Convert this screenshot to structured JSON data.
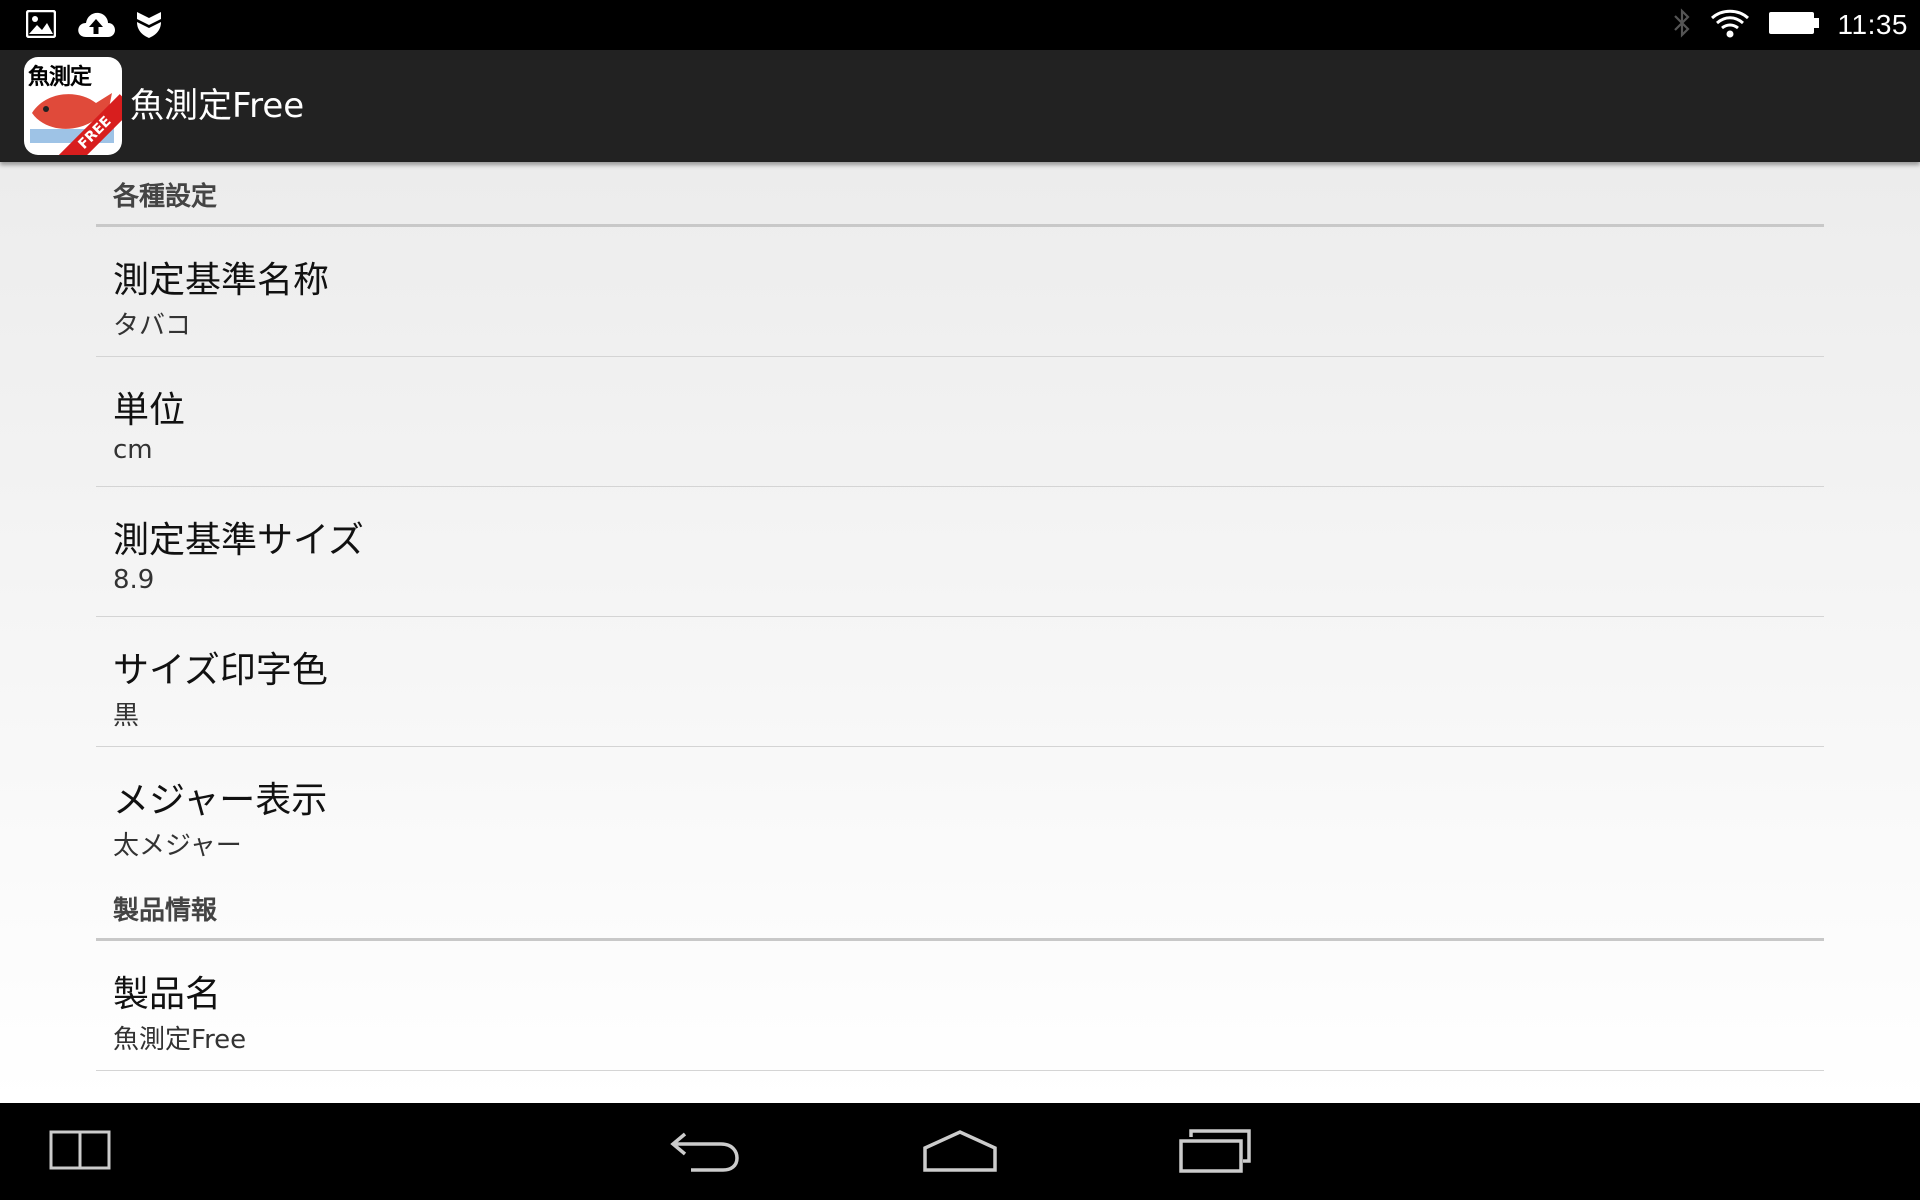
{
  "status_bar": {
    "time": "11:35",
    "left_icons": [
      "image-icon",
      "cloud-upload-icon",
      "shield-icon"
    ],
    "right_icons": [
      "bluetooth-icon",
      "wifi-icon",
      "battery-icon"
    ]
  },
  "action_bar": {
    "app_icon_text": "魚測定",
    "app_icon_badge": "FREE",
    "title": "魚測定Free"
  },
  "settings": {
    "category_general": "各種設定",
    "items": [
      {
        "title": "測定基準名称",
        "summary": "タバコ"
      },
      {
        "title": "単位",
        "summary": "cm"
      },
      {
        "title": "測定基準サイズ",
        "summary": "8.9"
      },
      {
        "title": "サイズ印字色",
        "summary": "黒"
      },
      {
        "title": "メジャー表示",
        "summary": "太メジャー"
      }
    ],
    "category_product": "製品情報",
    "product_items": [
      {
        "title": "製品名",
        "summary": "魚測定Free"
      }
    ]
  },
  "nav_bar": {
    "buttons": [
      "split-screen-icon",
      "back-icon",
      "home-icon",
      "recents-icon"
    ]
  },
  "colors": {
    "action_bar_bg": "#222222",
    "status_bar_bg": "#000000",
    "divider": "#c8c8c8"
  }
}
